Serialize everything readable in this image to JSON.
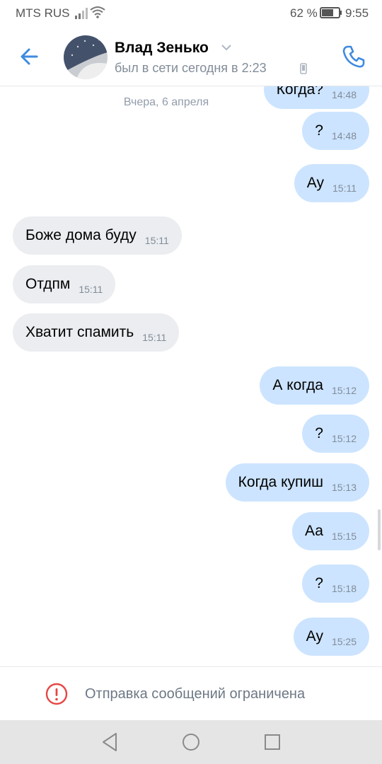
{
  "status_bar": {
    "carrier": "MTS RUS",
    "battery_percent": "62 %",
    "time": "9:55"
  },
  "header": {
    "contact_name": "Влад Зенько",
    "contact_status": "был в сети сегодня в 2:23"
  },
  "messages": [
    {
      "dir": "out",
      "text": "Когда?",
      "time": "14:48"
    },
    {
      "dir": "out",
      "text": "?",
      "time": "14:48"
    },
    {
      "dir": "out",
      "text": "Ау",
      "time": "15:11"
    },
    {
      "dir": "in",
      "text": "Боже дома буду",
      "time": "15:11"
    },
    {
      "dir": "in",
      "text": "Отдпм",
      "time": "15:11"
    },
    {
      "dir": "in",
      "text": "Хватит спамить",
      "time": "15:11"
    },
    {
      "dir": "out",
      "text": "А когда",
      "time": "15:12"
    },
    {
      "dir": "out",
      "text": "?",
      "time": "15:12"
    },
    {
      "dir": "out",
      "text": "Когда купиш",
      "time": "15:13"
    },
    {
      "dir": "out",
      "text": "Аа",
      "time": "15:15"
    },
    {
      "dir": "out",
      "text": "?",
      "time": "15:18"
    },
    {
      "dir": "out",
      "text": "Ау",
      "time": "15:25"
    }
  ],
  "date_separator": "Вчера, 6 апреля",
  "restricted_notice": "Отправка сообщений ограничена",
  "colors": {
    "accent": "#3f8ae0",
    "outgoing_bubble": "#cce4ff",
    "incoming_bubble": "#ebedf0",
    "warning": "#e64646"
  }
}
